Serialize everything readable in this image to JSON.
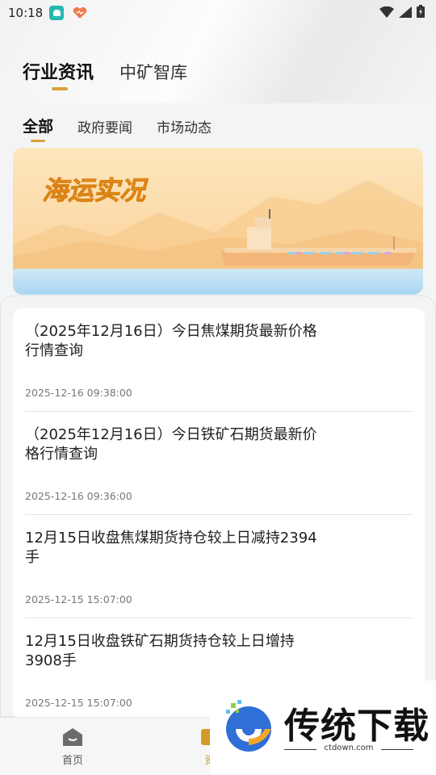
{
  "status_bar": {
    "time": "10:18"
  },
  "main_tabs": [
    {
      "label": "行业资讯",
      "active": true
    },
    {
      "label": "中矿智库",
      "active": false
    }
  ],
  "sub_tabs": [
    {
      "label": "全部",
      "active": true
    },
    {
      "label": "政府要闻",
      "active": false
    },
    {
      "label": "市场动态",
      "active": false
    }
  ],
  "banner": {
    "title": "海运实况"
  },
  "news": [
    {
      "title": "（2025年12月16日）今日焦煤期货最新价格行情查询",
      "date": "2025-12-16 09:38:00"
    },
    {
      "title": "（2025年12月16日）今日铁矿石期货最新价格行情查询",
      "date": "2025-12-16 09:36:00"
    },
    {
      "title": "12月15日收盘焦煤期货持仓较上日减持2394手",
      "date": "2025-12-15 15:07:00"
    },
    {
      "title": "12月15日收盘铁矿石期货持仓较上日增持3908手",
      "date": "2025-12-15 15:07:00"
    }
  ],
  "bottom_nav": [
    {
      "label": "首页",
      "icon": "home-icon",
      "active": false
    },
    {
      "label": "资",
      "icon": "news-icon",
      "active": true
    }
  ],
  "watermark": {
    "brand": "传统下载",
    "domain": "ctdown.com"
  },
  "colors": {
    "accent": "#d8a23a",
    "banner_sky": "#fde3b4",
    "banner_water": "#bfe1f7"
  }
}
